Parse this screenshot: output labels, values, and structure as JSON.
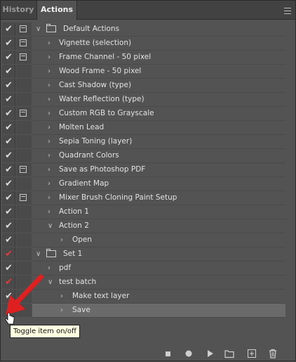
{
  "tabs": {
    "history": "History",
    "actions": "Actions"
  },
  "menu_icon": "panel-menu-icon",
  "rows": [
    {
      "label": "Default Actions",
      "check": "✔",
      "check_color": "#dcdcdc",
      "dialog": true,
      "kind": "set",
      "expanded": true
    },
    {
      "label": "Vignette (selection)",
      "check": "✔",
      "check_color": "#dcdcdc",
      "dialog": true,
      "kind": "action",
      "expanded": false
    },
    {
      "label": "Frame Channel - 50 pixel",
      "check": "✔",
      "check_color": "#dcdcdc",
      "dialog": true,
      "kind": "action",
      "expanded": false
    },
    {
      "label": "Wood Frame - 50 pixel",
      "check": "✔",
      "check_color": "#dcdcdc",
      "dialog": false,
      "kind": "action",
      "expanded": false
    },
    {
      "label": "Cast Shadow (type)",
      "check": "✔",
      "check_color": "#dcdcdc",
      "dialog": false,
      "kind": "action",
      "expanded": false
    },
    {
      "label": "Water Reflection (type)",
      "check": "✔",
      "check_color": "#dcdcdc",
      "dialog": false,
      "kind": "action",
      "expanded": false
    },
    {
      "label": "Custom RGB to Grayscale",
      "check": "✔",
      "check_color": "#dcdcdc",
      "dialog": true,
      "kind": "action",
      "expanded": false
    },
    {
      "label": "Molten Lead",
      "check": "✔",
      "check_color": "#dcdcdc",
      "dialog": false,
      "kind": "action",
      "expanded": false
    },
    {
      "label": "Sepia Toning (layer)",
      "check": "✔",
      "check_color": "#dcdcdc",
      "dialog": false,
      "kind": "action",
      "expanded": false
    },
    {
      "label": "Quadrant Colors",
      "check": "✔",
      "check_color": "#dcdcdc",
      "dialog": false,
      "kind": "action",
      "expanded": false
    },
    {
      "label": "Save as Photoshop PDF",
      "check": "✔",
      "check_color": "#dcdcdc",
      "dialog": true,
      "kind": "action",
      "expanded": false
    },
    {
      "label": "Gradient Map",
      "check": "✔",
      "check_color": "#dcdcdc",
      "dialog": false,
      "kind": "action",
      "expanded": false
    },
    {
      "label": "Mixer Brush Cloning Paint Setup",
      "check": "✔",
      "check_color": "#dcdcdc",
      "dialog": true,
      "kind": "action",
      "expanded": false
    },
    {
      "label": "Action 1",
      "check": "✔",
      "check_color": "#dcdcdc",
      "dialog": false,
      "kind": "action",
      "expanded": false
    },
    {
      "label": "Action 2",
      "check": "✔",
      "check_color": "#dcdcdc",
      "dialog": false,
      "kind": "action",
      "expanded": true
    },
    {
      "label": "Open",
      "check": "✔",
      "check_color": "#dcdcdc",
      "dialog": false,
      "kind": "step",
      "expanded": false
    },
    {
      "label": "Set 1",
      "check": "✔",
      "check_color": "#e13c3c",
      "dialog": false,
      "kind": "set",
      "expanded": true
    },
    {
      "label": "pdf",
      "check": "✔",
      "check_color": "#dcdcdc",
      "dialog": false,
      "kind": "action",
      "expanded": false
    },
    {
      "label": "test batch",
      "check": "✔",
      "check_color": "#e13c3c",
      "dialog": false,
      "kind": "action",
      "expanded": true
    },
    {
      "label": "Make text layer",
      "check": "✔",
      "check_color": "#dcdcdc",
      "dialog": false,
      "kind": "step",
      "expanded": false
    },
    {
      "label": "Save",
      "check": "",
      "check_color": "#dcdcdc",
      "dialog": false,
      "kind": "step",
      "expanded": false,
      "selected": true
    }
  ],
  "tooltip": "Toggle item on/off",
  "footer": {
    "buttons": [
      {
        "icon": "stop-icon",
        "glyph": "■"
      },
      {
        "icon": "record-icon",
        "glyph": "●"
      },
      {
        "icon": "play-icon",
        "glyph": "▶"
      },
      {
        "icon": "new-set-folder-icon",
        "glyph": ""
      },
      {
        "icon": "new-action-icon",
        "glyph": "⊞"
      },
      {
        "icon": "trash-icon",
        "glyph": "🗑"
      }
    ]
  },
  "colors": {
    "panel_bg": "#535353",
    "tab_bg": "#424242",
    "selected_row": "#6a6a6a",
    "arrow_red": "#e02020",
    "tooltip_bg": "#ffffe1"
  }
}
